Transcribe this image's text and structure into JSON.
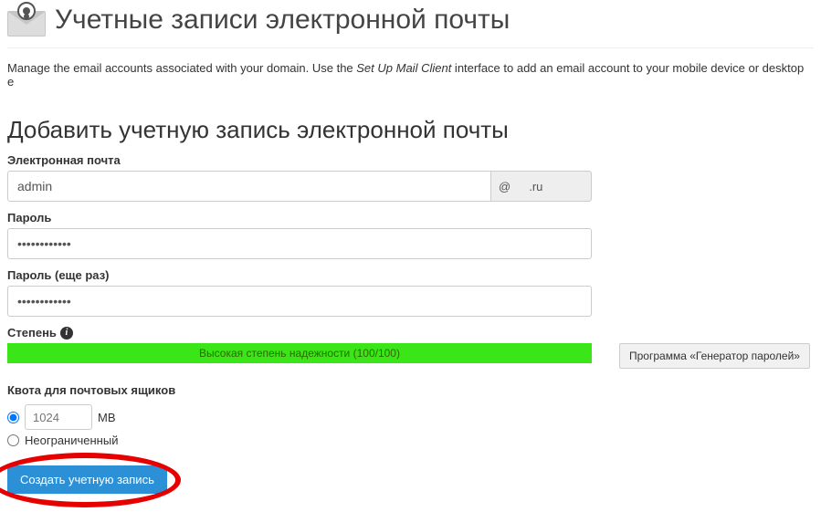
{
  "header": {
    "title": "Учетные записи электронной почты"
  },
  "intro": {
    "part1": "Manage the email accounts associated with your domain. Use the ",
    "em": "Set Up Mail Client",
    "part2": " interface to add an email account to your mobile device or desktop e"
  },
  "section": {
    "heading": "Добавить учетную запись электронной почты"
  },
  "fields": {
    "email_label": "Электронная почта",
    "email_value": "admin",
    "email_at": "@",
    "email_domain": ".ru",
    "password_label": "Пароль",
    "password_value": "••••••••••••",
    "password2_label": "Пароль (еще раз)",
    "password2_value": "••••••••••••",
    "strength_label": "Степень",
    "strength_text": "Высокая степень надежности (100/100)",
    "generator_button": "Программа «Генератор паролей»",
    "quota_label": "Квота для почтовых ящиков",
    "quota_value_placeholder": "1024",
    "quota_unit": "MB",
    "quota_unlimited": "Неограниченный",
    "submit": "Создать учетную запись"
  }
}
